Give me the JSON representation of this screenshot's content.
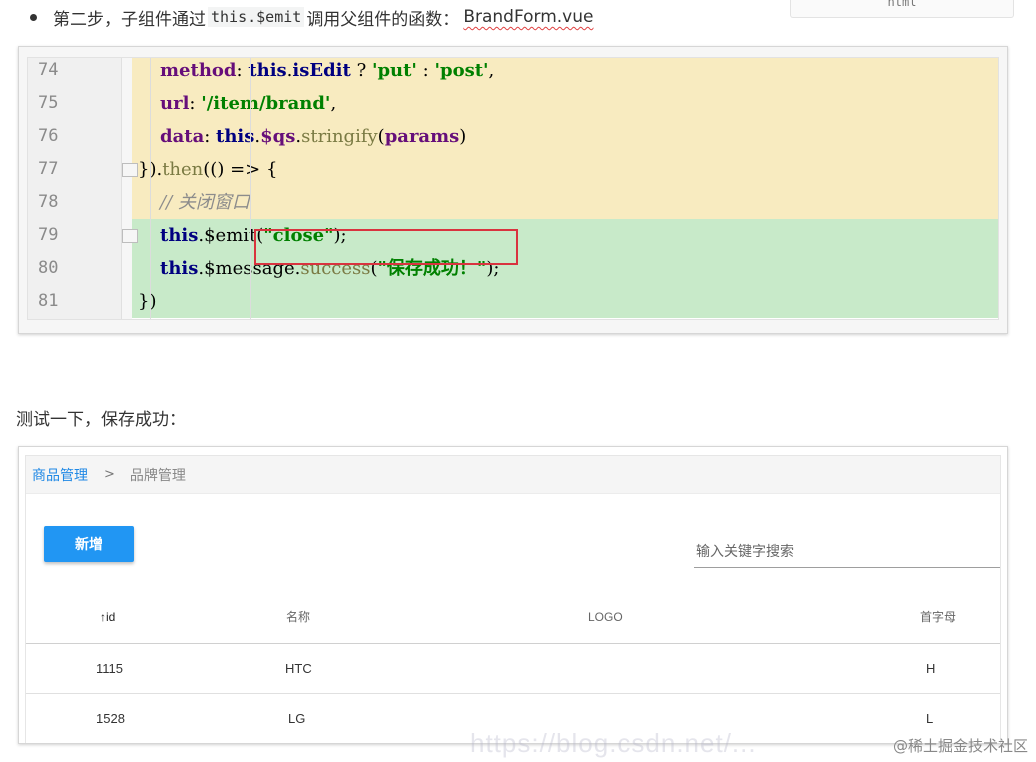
{
  "float_tab": {
    "label": "html"
  },
  "step": {
    "prefix": "第二步，子组件通过",
    "code": "this.$emit",
    "suffix": "调用父组件的函数：",
    "file": "BrandForm.vue"
  },
  "code_editor": {
    "lines": [
      {
        "no": "74",
        "bg": "yellow",
        "tokens": [
          [
            "prop",
            "method"
          ],
          [
            "plain",
            ": "
          ],
          [
            "kw",
            "this"
          ],
          [
            "plain",
            "."
          ],
          [
            "kw",
            "isEdit"
          ],
          [
            "plain",
            " ? "
          ],
          [
            "str",
            "'put'"
          ],
          [
            "plain",
            " : "
          ],
          [
            "str",
            "'post'"
          ],
          [
            "plain",
            ","
          ]
        ],
        "indent": 132
      },
      {
        "no": "75",
        "bg": "yellow",
        "tokens": [
          [
            "prop",
            "url"
          ],
          [
            "plain",
            ": "
          ],
          [
            "str",
            "'/item/brand'"
          ],
          [
            "plain",
            ","
          ]
        ],
        "indent": 132
      },
      {
        "no": "76",
        "bg": "yellow",
        "tokens": [
          [
            "prop",
            "data"
          ],
          [
            "plain",
            ": "
          ],
          [
            "kw",
            "this"
          ],
          [
            "plain",
            "."
          ],
          [
            "prop",
            "$qs"
          ],
          [
            "plain",
            "."
          ],
          [
            "fn",
            "stringify"
          ],
          [
            "plain",
            "("
          ],
          [
            "prop",
            "params"
          ],
          [
            "plain",
            ")"
          ]
        ],
        "indent": 132
      },
      {
        "no": "77",
        "bg": "yellow",
        "tokens": [
          [
            "plain",
            "})."
          ],
          [
            "fn",
            "then"
          ],
          [
            "plain",
            "(() => {"
          ]
        ],
        "indent": 110
      },
      {
        "no": "78",
        "bg": "yellow",
        "tokens": [
          [
            "comment",
            "// 关闭窗口"
          ]
        ],
        "indent": 132
      },
      {
        "no": "79",
        "bg": "green",
        "tokens": [
          [
            "kw",
            "this"
          ],
          [
            "plain",
            "."
          ],
          [
            "plain",
            "$emit("
          ],
          [
            "str",
            "\"close\""
          ],
          [
            "plain",
            ");"
          ]
        ],
        "indent": 132
      },
      {
        "no": "80",
        "bg": "green",
        "tokens": [
          [
            "kw",
            "this"
          ],
          [
            "plain",
            "."
          ],
          [
            "plain",
            "$message."
          ],
          [
            "fn",
            "success"
          ],
          [
            "plain",
            "("
          ],
          [
            "str",
            "\"保存成功！\""
          ],
          [
            "plain",
            ");"
          ]
        ],
        "indent": 132
      },
      {
        "no": "81",
        "bg": "green",
        "tokens": [
          [
            "plain",
            "})"
          ]
        ],
        "indent": 110
      }
    ]
  },
  "paragraph": "测试一下，保存成功：",
  "app": {
    "breadcrumb": {
      "parent": "商品管理",
      "separator": ">",
      "current": "品牌管理"
    },
    "add_button": "新增",
    "search_placeholder": "输入关键字搜索",
    "table": {
      "headers": {
        "id": "id",
        "sort_arrow": "↑",
        "name": "名称",
        "logo": "LOGO",
        "letter": "首字母"
      },
      "rows": [
        {
          "id": "1115",
          "name": "HTC",
          "logo": "",
          "letter": "H"
        },
        {
          "id": "1528",
          "name": "LG",
          "logo": "",
          "letter": "L"
        }
      ]
    }
  },
  "watermark": "@稀土掘金技术社区",
  "faint_url": "https://blog.csdn.net/..."
}
